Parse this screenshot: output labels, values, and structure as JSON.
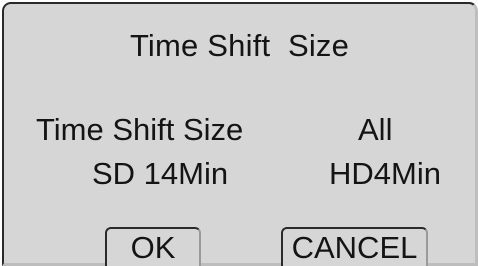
{
  "dialog": {
    "title": "Time Shift  Size",
    "rows": [
      {
        "label": "Time Shift Size",
        "value": "All"
      },
      {
        "label": "SD 14Min",
        "value": "HD4Min"
      }
    ],
    "buttons": {
      "ok_label": "OK",
      "cancel_label": "CANCEL"
    }
  },
  "colors": {
    "background": "#d6d6d6",
    "text": "#141414",
    "border_dark": "#2a2a2a",
    "border_light": "#bdbdbd"
  }
}
